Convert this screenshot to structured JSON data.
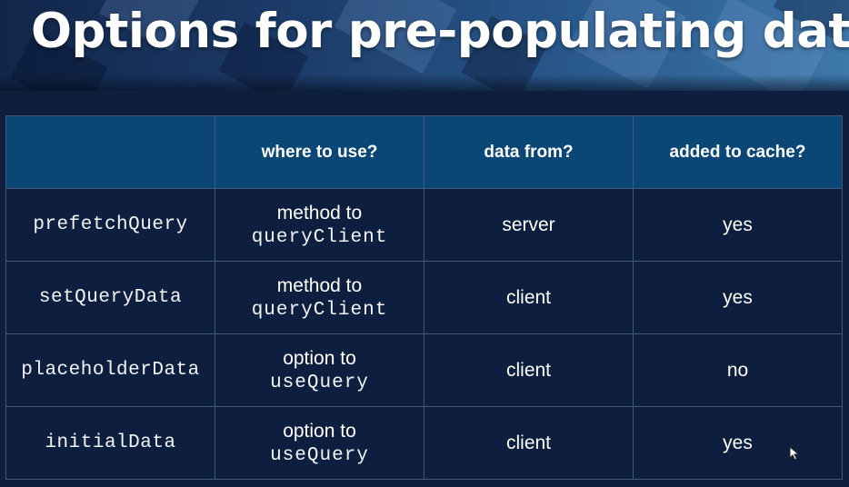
{
  "slide": {
    "title": "Options for pre-populating data"
  },
  "table": {
    "headers": [
      "",
      "where to use?",
      "data from?",
      "added to cache?"
    ],
    "rows": [
      {
        "name": "prefetchQuery",
        "where_text": "method to",
        "where_code": "queryClient",
        "data_from": "server",
        "added_to_cache": "yes"
      },
      {
        "name": "setQueryData",
        "where_text": "method to",
        "where_code": "queryClient",
        "data_from": "client",
        "added_to_cache": "yes"
      },
      {
        "name": "placeholderData",
        "where_text": "option to",
        "where_code": "useQuery",
        "data_from": "client",
        "added_to_cache": "no"
      },
      {
        "name": "initialData",
        "where_text": "option to",
        "where_code": "useQuery",
        "data_from": "client",
        "added_to_cache": "yes"
      }
    ]
  },
  "colors": {
    "header_row": "#0a4676",
    "body_row": "#0d1e3e",
    "border": "#41577a",
    "text": "#ffffff"
  },
  "icons": {
    "cursor": "mouse-pointer-icon"
  }
}
